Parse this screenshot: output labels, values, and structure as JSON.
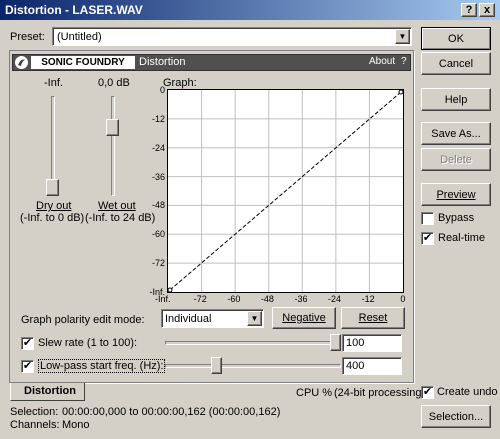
{
  "window": {
    "title": "Distortion - LASER.WAV",
    "help_btn": "?",
    "close_btn": "x"
  },
  "preset": {
    "label": "Preset:",
    "value": "(Untitled)"
  },
  "plugin_header": {
    "brand": "SONIC FOUNDRY",
    "name": "Distortion",
    "about": "About",
    "help": "?"
  },
  "sliders": {
    "dry": {
      "top_value": "-Inf.",
      "label": "Dry out",
      "range": "(-Inf. to 0 dB)",
      "level": 0.0
    },
    "wet": {
      "top_value": "0,0 dB",
      "label": "Wet out",
      "range": "(-Inf. to 24 dB)",
      "level": 0.72
    }
  },
  "graph": {
    "label": "Graph:",
    "y_ticks": [
      "0",
      "-12",
      "-24",
      "-36",
      "-48",
      "-60",
      "-72",
      "-Inf."
    ],
    "x_ticks": [
      "-Inf.",
      "-72",
      "-60",
      "-48",
      "-36",
      "-24",
      "-12",
      "0"
    ]
  },
  "polarity": {
    "label": "Graph polarity edit mode:",
    "value": "Individual",
    "negative_btn": "Negative",
    "reset_btn": "Reset"
  },
  "slew": {
    "checked": true,
    "label": "Slew rate (1 to 100):",
    "value": "100",
    "level": 1.0
  },
  "lowpass": {
    "checked": true,
    "label": "Low-pass start freq. (Hz):",
    "value": "400",
    "level": 0.28
  },
  "buttons": {
    "ok": "OK",
    "cancel": "Cancel",
    "help": "Help",
    "save_as": "Save As...",
    "delete": "Delete",
    "preview": "Preview",
    "selection": "Selection..."
  },
  "options": {
    "bypass": {
      "label": "Bypass",
      "checked": false
    },
    "realtime": {
      "label": "Real-time",
      "checked": true
    },
    "create_undo": {
      "label": "Create undo",
      "checked": true
    }
  },
  "tab": {
    "label": "Distortion"
  },
  "cpu": {
    "label": "CPU %",
    "processing": "(24-bit processing)"
  },
  "status": {
    "selection_label": "Selection:",
    "selection_value": "00:00:00,000 to 00:00:00,162 (00:00:00,162)",
    "channels_label": "Channels:",
    "channels_value": "Mono"
  }
}
